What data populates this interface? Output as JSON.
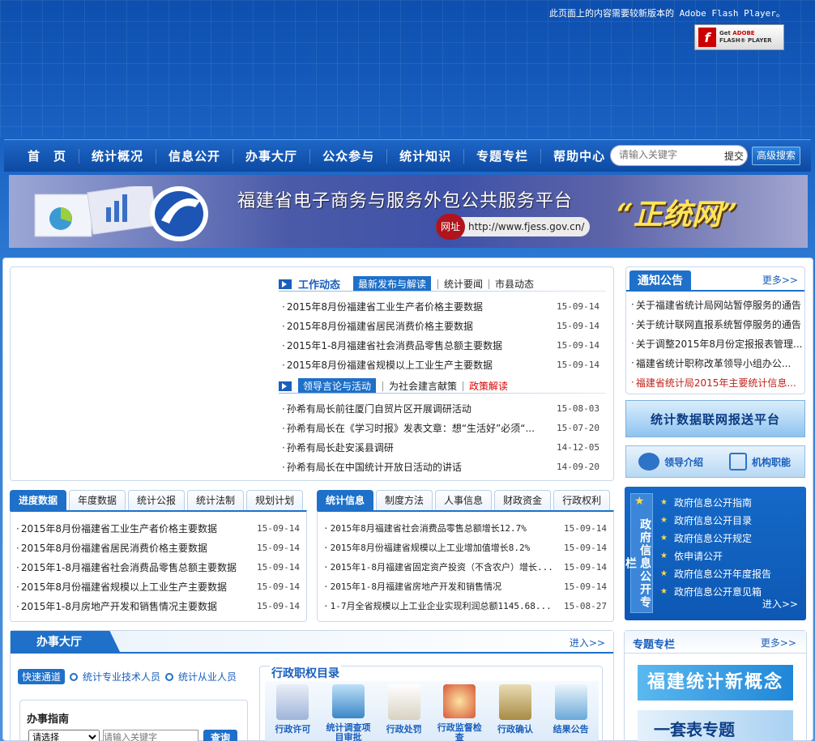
{
  "header": {
    "flash_notice": "此页面上的内容需要较新版本的 Adobe Flash Player。",
    "flash_button_line1": "Get",
    "flash_button_brand": "ADOBE",
    "flash_button_line2": "FLASH® PLAYER"
  },
  "nav": {
    "items": [
      "首　页",
      "统计概况",
      "信息公开",
      "办事大厅",
      "公众参与",
      "统计知识",
      "专题专栏",
      "帮助中心"
    ],
    "search_placeholder": "请输入关键字",
    "submit": "提交",
    "advanced_search": "高级搜索"
  },
  "banner": {
    "title": "福建省电子商务与服务外包公共服务平台",
    "slogan": "“正统网”",
    "url_label": "网址",
    "url": "http://www.fjess.gov.cn/"
  },
  "work": {
    "title": "工作动态",
    "tabs": [
      "最新发布与解读",
      "统计要闻",
      "市县动态"
    ],
    "items": [
      {
        "text": "2015年8月份福建省工业生产者价格主要数据",
        "date": "15-09-14"
      },
      {
        "text": "2015年8月份福建省居民消费价格主要数据",
        "date": "15-09-14"
      },
      {
        "text": "2015年1-8月福建省社会消费品零售总额主要数据",
        "date": "15-09-14"
      },
      {
        "text": "2015年8月份福建省规模以上工业生产主要数据",
        "date": "15-09-14"
      }
    ]
  },
  "leader": {
    "tabs": [
      "领导言论与活动",
      "为社会建言献策",
      "政策解读"
    ],
    "items": [
      {
        "text": "孙希有局长前往厦门自贸片区开展调研活动",
        "date": "15-08-03"
      },
      {
        "text": "孙希有局长在《学习时报》发表文章：想“生活好”必须“...",
        "date": "15-07-20"
      },
      {
        "text": "孙希有局长赴安溪县调研",
        "date": "14-12-05"
      },
      {
        "text": "孙希有局长在中国统计开放日活动的讲话",
        "date": "14-09-20"
      }
    ]
  },
  "notice": {
    "title": "通知公告",
    "more": "更多>>",
    "items": [
      "关于福建省统计局网站暂停服务的通告",
      "关于统计联网直报系统暂停服务的通告",
      "关于调整2015年8月份定报报表管理...",
      "福建省统计职称改革领导小组办公...",
      "福建省统计局2015年主要统计信息..."
    ]
  },
  "side": {
    "stat_platform": "统计数据联网报送平台",
    "leader_intro": "领导介绍",
    "org_function": "机构职能"
  },
  "progress": {
    "tabs": [
      "进度数据",
      "年度数据",
      "统计公报",
      "统计法制",
      "规划计划"
    ],
    "items": [
      {
        "text": "2015年8月份福建省工业生产者价格主要数据",
        "date": "15-09-14"
      },
      {
        "text": "2015年8月份福建省居民消费价格主要数据",
        "date": "15-09-14"
      },
      {
        "text": "2015年1-8月福建省社会消费品零售总额主要数据",
        "date": "15-09-14"
      },
      {
        "text": "2015年8月份福建省规模以上工业生产主要数据",
        "date": "15-09-14"
      },
      {
        "text": "2015年1-8月房地产开发和销售情况主要数据",
        "date": "15-09-14"
      }
    ]
  },
  "statinfo": {
    "tabs": [
      "统计信息",
      "制度方法",
      "人事信息",
      "财政资金",
      "行政权利"
    ],
    "items": [
      {
        "text": "2015年8月福建省社会消费品零售总额增长12.7%",
        "date": "15-09-14"
      },
      {
        "text": "2015年8月份福建省规模以上工业增加值增长8.2%",
        "date": "15-09-14"
      },
      {
        "text": "2015年1-8月福建省固定资产投资（不含农户）增长...",
        "date": "15-09-14"
      },
      {
        "text": "2015年1-8月福建省房地产开发和销售情况",
        "date": "15-09-14"
      },
      {
        "text": "1-7月全省规模以上工业企业实现利润总额1145.68...",
        "date": "15-08-27"
      }
    ]
  },
  "gov": {
    "vertical_title": "政府信息公开专栏",
    "items": [
      "政府信息公开指南",
      "政府信息公开目录",
      "政府信息公开规定",
      "依申请公开",
      "政府信息公开年度报告",
      "政府信息公开意见箱"
    ],
    "enter": "进入>>"
  },
  "hall": {
    "title": "办事大厅",
    "enter": "进入>>",
    "fast_label": "快速通道",
    "fast_links": [
      "统计专业技术人员",
      "统计从业人员"
    ],
    "guide_title": "办事指南",
    "select_value": "请选择",
    "input_placeholder": "请输入关键字",
    "query": "查询",
    "power_title": "行政职权目录",
    "power_items": [
      "行政许可",
      "统计调查项目审批",
      "行政处罚",
      "行政监督检查",
      "行政确认",
      "结果公告"
    ]
  },
  "topic": {
    "title": "专题专栏",
    "more": "更多>>",
    "image1_text": "福建统计新概念",
    "image2_text": "一套表专题"
  }
}
